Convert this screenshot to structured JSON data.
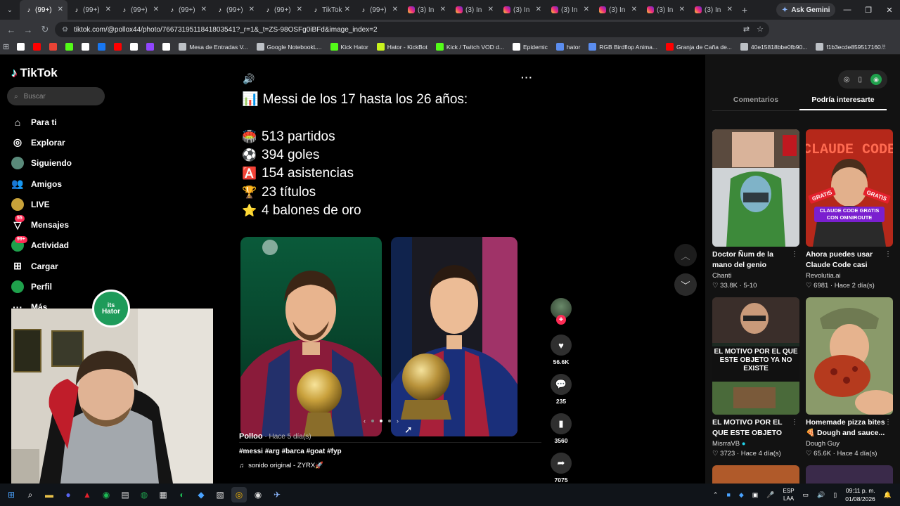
{
  "browser": {
    "tabs": [
      {
        "label": "(99+)",
        "icon": "tiktok-icon",
        "active": true
      },
      {
        "label": "(99+)",
        "icon": "tiktok-icon"
      },
      {
        "label": "(99+)",
        "icon": "tiktok-icon"
      },
      {
        "label": "(99+)",
        "icon": "tiktok-icon"
      },
      {
        "label": "(99+)",
        "icon": "tiktok-icon"
      },
      {
        "label": "(99+)",
        "icon": "tiktok-icon"
      },
      {
        "label": "TikTok",
        "icon": "tiktok-icon"
      },
      {
        "label": "(99+)",
        "icon": "tiktok-icon"
      },
      {
        "label": "(3) In",
        "icon": "instagram-icon"
      },
      {
        "label": "(3) In",
        "icon": "instagram-icon"
      },
      {
        "label": "(3) In",
        "icon": "instagram-icon"
      },
      {
        "label": "(3) In",
        "icon": "instagram-icon"
      },
      {
        "label": "(3) In",
        "icon": "instagram-icon"
      },
      {
        "label": "(3) In",
        "icon": "instagram-icon"
      },
      {
        "label": "(3) In",
        "icon": "instagram-icon"
      }
    ],
    "ask_gemini": "Ask Gemini",
    "url": "tiktok.com/@pollox44/photo/7667319511841803541?_r=1&_t=ZS-98OSFg0iBFd&image_index=2",
    "bookmarks": [
      {
        "label": "",
        "icon": "notion-icon",
        "color": "#ffffff"
      },
      {
        "label": "",
        "icon": "youtube-icon",
        "color": "#ff0000"
      },
      {
        "label": "",
        "icon": "gmail-icon",
        "color": "#ea4335"
      },
      {
        "label": "",
        "icon": "kick-icon",
        "color": "#53fc18"
      },
      {
        "label": "",
        "icon": "tiktok-icon",
        "color": "#ffffff"
      },
      {
        "label": "",
        "icon": "meta-icon",
        "color": "#1877f2"
      },
      {
        "label": "",
        "icon": "youtube-icon",
        "color": "#ff0000"
      },
      {
        "label": "",
        "icon": "github-icon",
        "color": "#ffffff"
      },
      {
        "label": "",
        "icon": "streamelements-icon",
        "color": "#9146ff"
      },
      {
        "label": "",
        "icon": "medium-icon",
        "color": "#ffffff"
      },
      {
        "label": "Mesa de Entradas V...",
        "icon": "globe-icon",
        "color": "#bdc1c6"
      },
      {
        "label": "Google NotebookL...",
        "icon": "globe-icon",
        "color": "#bdc1c6"
      },
      {
        "label": "Kick Hator",
        "icon": "kick-icon",
        "color": "#53fc18"
      },
      {
        "label": "Hator - KickBot",
        "icon": "kickbot-icon",
        "color": "#c8f31d"
      },
      {
        "label": "Kick / Twitch VOD d...",
        "icon": "vod-icon",
        "color": "#53fc18"
      },
      {
        "label": "Epidemic",
        "icon": "epidemic-icon",
        "color": "#ffffff"
      },
      {
        "label": "hator",
        "icon": "hator-icon",
        "color": "#5b8def"
      },
      {
        "label": "RGB Birdflop Anima...",
        "icon": "birdflop-icon",
        "color": "#5b8def"
      },
      {
        "label": "Granja de Caña de...",
        "icon": "youtube-icon",
        "color": "#ff0000"
      },
      {
        "label": "40e15818bbe0fb90...",
        "icon": "globe-icon",
        "color": "#bdc1c6"
      },
      {
        "label": "f1b3ecde859517160...",
        "icon": "globe-icon",
        "color": "#bdc1c6"
      }
    ]
  },
  "tiktok": {
    "logo": "TikTok",
    "search_placeholder": "Buscar",
    "nav": [
      {
        "label": "Para ti",
        "icon": "home-icon"
      },
      {
        "label": "Explorar",
        "icon": "compass-icon"
      },
      {
        "label": "Siguiendo",
        "icon": "following-avatar-icon"
      },
      {
        "label": "Amigos",
        "icon": "friends-icon"
      },
      {
        "label": "LIVE",
        "icon": "live-avatar-icon"
      },
      {
        "label": "Mensajes",
        "icon": "messages-icon",
        "badge": "55"
      },
      {
        "label": "Actividad",
        "icon": "activity-icon",
        "badge": "99+"
      },
      {
        "label": "Cargar",
        "icon": "upload-icon"
      },
      {
        "label": "Perfil",
        "icon": "profile-avatar-icon"
      },
      {
        "label": "Más",
        "icon": "more-icon"
      }
    ],
    "post": {
      "headline_emoji": "📊",
      "headline": "Messi de los 17 hasta los 26 años:",
      "stats": [
        {
          "emoji": "🏟️",
          "text": "513 partidos"
        },
        {
          "emoji": "⚽",
          "text": "394 goles"
        },
        {
          "emoji": "🅰️",
          "text": "154 asistencias"
        },
        {
          "emoji": "🏆",
          "text": "23 títulos"
        },
        {
          "emoji": "⭐",
          "text": "4 balones de oro"
        }
      ],
      "author": "Polloo",
      "time": " · Hace 5 día(s)",
      "hashtags": "#messi #arg #barca #goat #fyp",
      "music": "sonido original - ZYRX🚀",
      "likes": "56.6K",
      "comments": "235",
      "saves": "3560",
      "shares": "7075"
    },
    "right_panel": {
      "tabs": [
        "Comentarios",
        "Podría interesarte"
      ],
      "active_tab": 1,
      "cards": [
        {
          "title": "Doctor Ñum de la mano del genio Nanno. Si n...",
          "author": "Chanti",
          "likes": "33.8K",
          "date": "5-10"
        },
        {
          "title": "Ahora puedes usar Claude Code casi con...",
          "author": "Revolutia.ai",
          "likes": "6981",
          "date": "Hace 2 día(s)"
        },
        {
          "title": "EL MOTIVO POR EL QUE ESTE OBJETO YA...",
          "author": "MisrraVB",
          "likes": "3723",
          "date": "Hace 4 día(s)",
          "verified": true
        },
        {
          "title": "Homemade pizza bites 🍕 Dough and sauce...",
          "author": "Dough Guy",
          "likes": "65.6K",
          "date": "Hace 4 día(s)"
        }
      ],
      "thumb_texts": {
        "claude_top": "CLAUDE CODE",
        "gratis": "GRATIS",
        "claude_banner": "CLAUDE CODE GRATIS CON OMNIROUTE",
        "motivo": "EL MOTIVO POR EL QUE ESTE OBJETO YA NO EXISTE"
      }
    }
  },
  "overlay": {
    "hator_badge_line1": "its",
    "hator_badge_line2": "Hator"
  },
  "taskbar": {
    "lang_line1": "ESP",
    "lang_line2": "LAA",
    "time": "09:11 p. m.",
    "date": "01/08/2026"
  },
  "colors": {
    "tiktok_red": "#fe2c55",
    "tiktok_cyan": "#25f4ee",
    "chrome_dark": "#202124",
    "hator_green": "#1e9b5a"
  }
}
